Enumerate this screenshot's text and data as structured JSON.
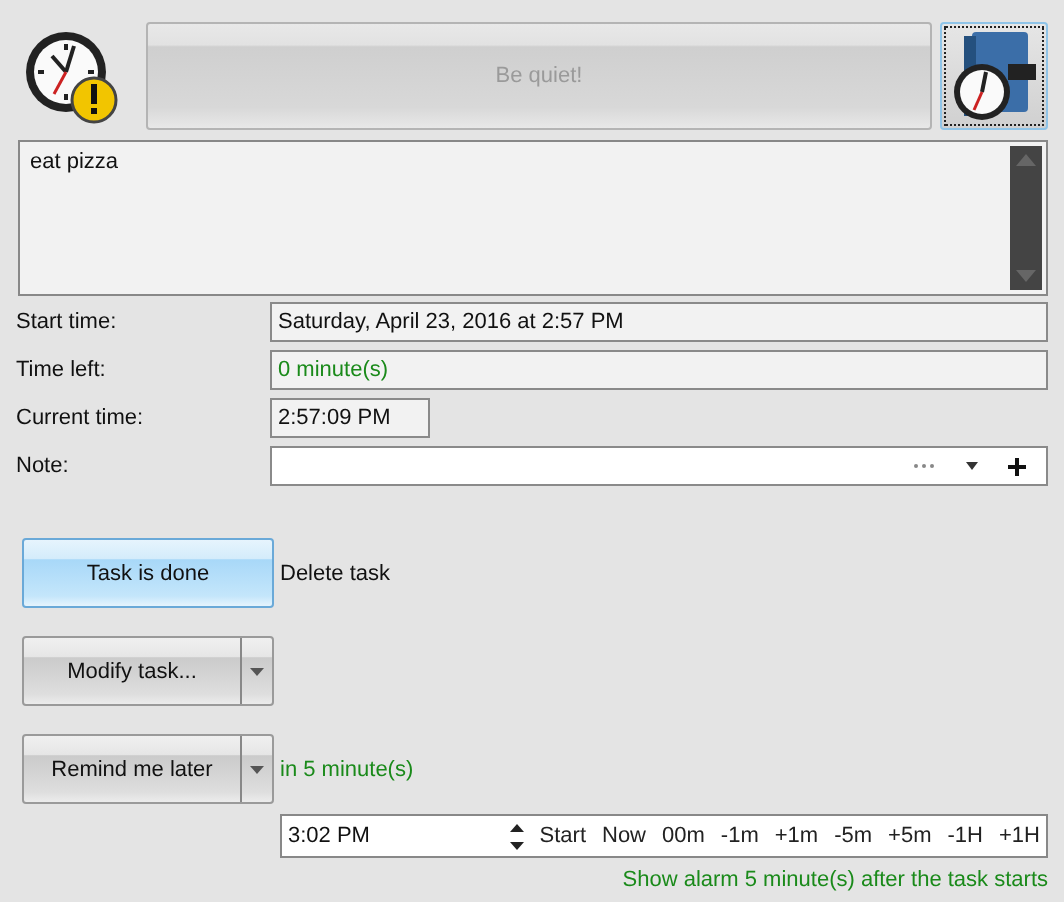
{
  "quiet_button": {
    "label": "Be quiet!",
    "disabled": true
  },
  "message": {
    "value": "eat pizza"
  },
  "fields": [
    {
      "label": "Start time:",
      "value": "Saturday, April 23, 2016 at 2:57 PM",
      "kind": "wide"
    },
    {
      "label": "Time left:",
      "value": "0 minute(s)",
      "kind": "status"
    },
    {
      "label": "Current time:",
      "value": "2:57:09 PM",
      "kind": "short"
    },
    {
      "label": "Note:",
      "kind": "note"
    }
  ],
  "actions": [
    {
      "label": "Task is done",
      "kind": "plain",
      "highlighted": true,
      "side_text": "Delete task",
      "side_link": true
    },
    {
      "label": "Modify task...",
      "kind": "split",
      "highlighted": false
    },
    {
      "label": "Remind me later",
      "kind": "split",
      "highlighted": false,
      "side_text": "in 5 minute(s)",
      "side_link": false
    }
  ],
  "time_picker": {
    "value": "3:02 PM",
    "buttons": [
      "Start",
      "Now",
      "00m",
      "-1m",
      "+1m",
      "-5m",
      "+5m",
      "-1H",
      "+1H"
    ]
  },
  "footer": "Show alarm 5 minute(s) after the task starts"
}
